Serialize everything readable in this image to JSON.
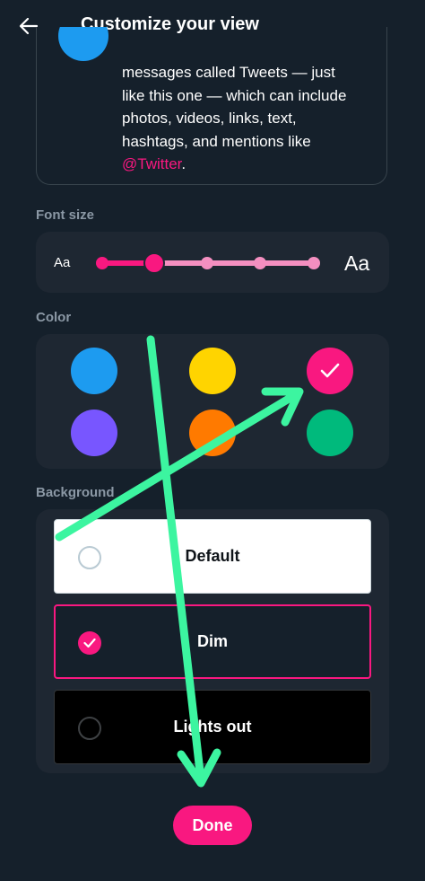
{
  "header": {
    "title": "Customize your view",
    "back_icon": "arrow-left-icon"
  },
  "preview": {
    "lines": [
      "messages called Tweets — just",
      "like this one — which can include",
      "photos, videos, links, text,",
      "hashtags, and mentions like"
    ],
    "mention": "@Twitter",
    "mention_suffix": ".",
    "avatar_color": "#1d9bf0"
  },
  "font_size": {
    "label": "Font size",
    "small_label": "Aa",
    "large_label": "Aa",
    "steps": 5,
    "selected_step": 2,
    "accent": "#f91880"
  },
  "color": {
    "label": "Color",
    "options": [
      {
        "name": "blue",
        "hex": "#1d9bf0",
        "selected": false
      },
      {
        "name": "yellow",
        "hex": "#ffd400",
        "selected": false
      },
      {
        "name": "pink",
        "hex": "#f91880",
        "selected": true
      },
      {
        "name": "purple",
        "hex": "#7856ff",
        "selected": false
      },
      {
        "name": "orange",
        "hex": "#ff7a00",
        "selected": false
      },
      {
        "name": "green",
        "hex": "#00ba7c",
        "selected": false
      }
    ]
  },
  "background": {
    "label": "Background",
    "options": [
      {
        "label": "Default",
        "selected": false,
        "bg": "#ffffff",
        "fg": "#0f1419"
      },
      {
        "label": "Dim",
        "selected": true,
        "bg": "#15202b",
        "fg": "#ffffff"
      },
      {
        "label": "Lights out",
        "selected": false,
        "bg": "#000000",
        "fg": "#ffffff"
      }
    ]
  },
  "done_label": "Done",
  "annotation_color": "#3cf5a0"
}
